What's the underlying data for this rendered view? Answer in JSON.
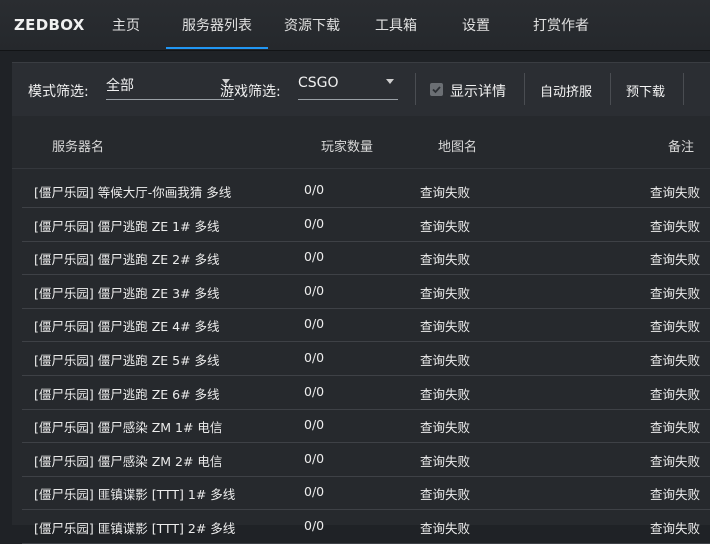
{
  "app": {
    "brand": "ZEDBOX"
  },
  "nav": {
    "items": [
      "主页",
      "服务器列表",
      "资源下载",
      "工具箱",
      "设置",
      "打赏作者"
    ],
    "active": "服务器列表"
  },
  "toolbar": {
    "mode_label": "模式筛选:",
    "mode_value": "全部",
    "game_label": "游戏筛选:",
    "game_value": "CSGO",
    "show_details_label": "显示详情",
    "show_details_checked": true,
    "auto_join_label": "自动挤服",
    "predownload_label": "预下载"
  },
  "table": {
    "headers": {
      "name": "服务器名",
      "players": "玩家数量",
      "map": "地图名",
      "note": "备注"
    },
    "rows": [
      {
        "name": "[僵尸乐园] 等候大厅-你画我猜 多线",
        "players": "0/0",
        "map": "查询失败",
        "note": "查询失败"
      },
      {
        "name": "[僵尸乐园] 僵尸逃跑 ZE 1# 多线",
        "players": "0/0",
        "map": "查询失败",
        "note": "查询失败"
      },
      {
        "name": "[僵尸乐园] 僵尸逃跑 ZE 2# 多线",
        "players": "0/0",
        "map": "查询失败",
        "note": "查询失败"
      },
      {
        "name": "[僵尸乐园] 僵尸逃跑 ZE 3# 多线",
        "players": "0/0",
        "map": "查询失败",
        "note": "查询失败"
      },
      {
        "name": "[僵尸乐园] 僵尸逃跑 ZE 4# 多线",
        "players": "0/0",
        "map": "查询失败",
        "note": "查询失败"
      },
      {
        "name": "[僵尸乐园] 僵尸逃跑 ZE 5# 多线",
        "players": "0/0",
        "map": "查询失败",
        "note": "查询失败"
      },
      {
        "name": "[僵尸乐园] 僵尸逃跑 ZE 6# 多线",
        "players": "0/0",
        "map": "查询失败",
        "note": "查询失败"
      },
      {
        "name": "[僵尸乐园] 僵尸感染 ZM 1# 电信",
        "players": "0/0",
        "map": "查询失败",
        "note": "查询失败"
      },
      {
        "name": "[僵尸乐园] 僵尸感染 ZM 2# 电信",
        "players": "0/0",
        "map": "查询失败",
        "note": "查询失败"
      },
      {
        "name": "[僵尸乐园] 匪镇谍影 [TTT] 1# 多线",
        "players": "0/0",
        "map": "查询失败",
        "note": "查询失败"
      },
      {
        "name": "[僵尸乐园] 匪镇谍影 [TTT] 2# 多线",
        "players": "0/0",
        "map": "查询失败",
        "note": "查询失败"
      }
    ]
  },
  "colors": {
    "accent": "#2196f3",
    "background": "#1f2226",
    "panel": "#26292d"
  }
}
